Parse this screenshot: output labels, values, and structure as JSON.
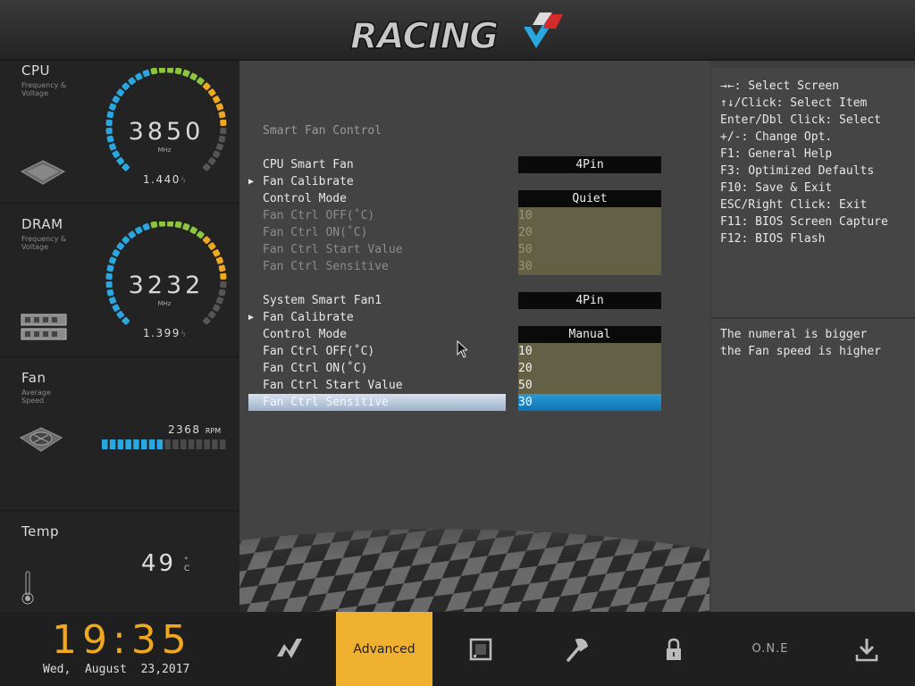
{
  "header": {
    "logo_text": "RACING"
  },
  "monitor": {
    "cpu": {
      "title": "CPU",
      "subtitle": "Frequency & Voltage",
      "value": "3850",
      "unit": "MHz",
      "voltage": "1.440",
      "icon": "cpu-chip-icon"
    },
    "dram": {
      "title": "DRAM",
      "subtitle": "Frequency & Voltage",
      "value": "3232",
      "unit": "MHz",
      "voltage": "1.399",
      "icon": "memory-stick-icon"
    },
    "fan": {
      "title": "Fan",
      "subtitle": "Average Speed",
      "value": "2368",
      "unit": "RPM",
      "level_fraction": 0.5,
      "icon": "fan-icon"
    },
    "temp": {
      "title": "Temp",
      "value": "49",
      "unit": "°C",
      "icon": "thermometer-icon"
    }
  },
  "settings": {
    "section_title": "Smart Fan Control",
    "cpu_fan": {
      "label": "CPU Smart Fan",
      "value": "4Pin",
      "calibrate": "Fan Calibrate",
      "mode_label": "Control Mode",
      "mode_value": "Quiet",
      "off_label": "Fan Ctrl OFF(˚C)",
      "off_value": "10",
      "on_label": "Fan Ctrl ON(˚C)",
      "on_value": "20",
      "start_label": "Fan Ctrl Start Value",
      "start_value": "50",
      "sens_label": "Fan Ctrl Sensitive",
      "sens_value": "30"
    },
    "sys_fan1": {
      "label": "System Smart Fan1",
      "value": "4Pin",
      "calibrate": "Fan Calibrate",
      "mode_label": "Control Mode",
      "mode_value": "Manual",
      "off_label": "Fan Ctrl OFF(˚C)",
      "off_value": "10",
      "on_label": "Fan Ctrl ON(˚C)",
      "on_value": "20",
      "start_label": "Fan Ctrl Start Value",
      "start_value": "50",
      "sens_label": "Fan Ctrl Sensitive",
      "sens_value": "30"
    }
  },
  "help": {
    "lines": [
      "→←: Select Screen",
      "↑↓/Click: Select Item",
      "Enter/Dbl Click: Select",
      "+/-: Change Opt.",
      "F1: General Help",
      "F3: Optimized Defaults",
      "F10: Save & Exit",
      "ESC/Right Click: Exit",
      "F11: BIOS Screen Capture",
      "F12: BIOS Flash"
    ],
    "description": [
      "The numeral is bigger",
      "the Fan speed is higher"
    ]
  },
  "footer": {
    "time": "19:35",
    "date": "Wed,  August  23,2017",
    "nav": [
      {
        "id": "main",
        "icon": "racing-logo-icon"
      },
      {
        "id": "advanced",
        "label": "Advanced",
        "active": true
      },
      {
        "id": "chipset",
        "icon": "chip-icon"
      },
      {
        "id": "tools",
        "icon": "wrench-icon"
      },
      {
        "id": "security",
        "icon": "lock-icon"
      },
      {
        "id": "one",
        "label": "O.N.E"
      },
      {
        "id": "save",
        "icon": "download-icon"
      }
    ]
  },
  "colors": {
    "accent": "#f0b030",
    "gauge_blue": "#2aa7e0",
    "gauge_green": "#8cc63f",
    "gauge_orange": "#f0a820",
    "selection": "#1a88c8"
  }
}
